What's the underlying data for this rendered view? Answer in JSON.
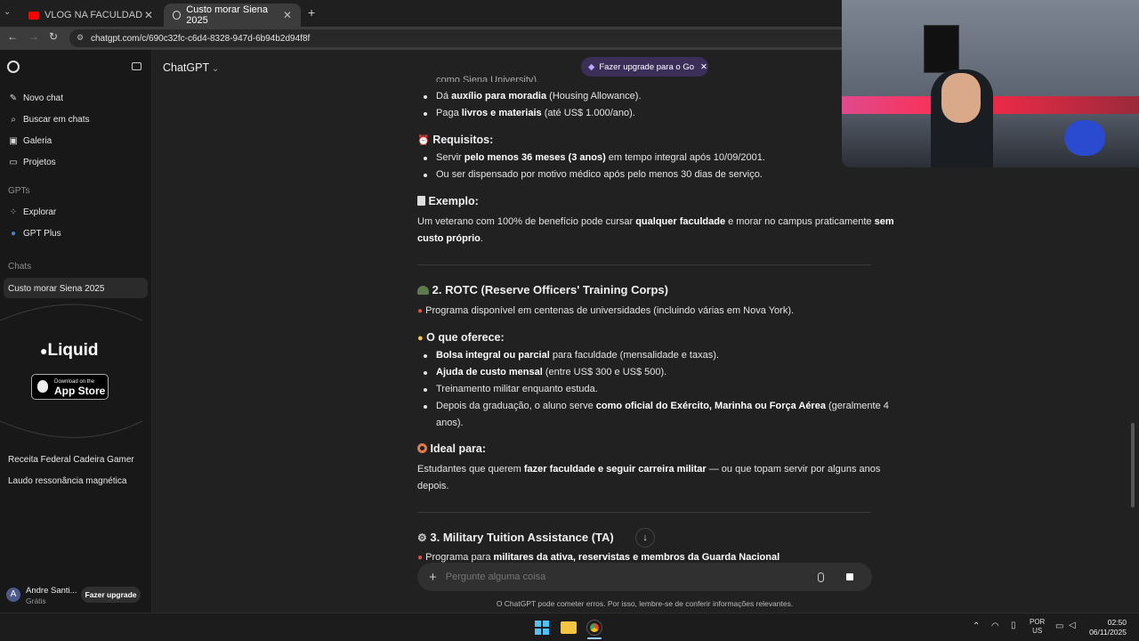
{
  "browser": {
    "tabs": [
      {
        "label": "VLOG NA FACULDADE EM NY"
      },
      {
        "label": "Custo morar Siena 2025"
      }
    ],
    "url": "chatgpt.com/c/690c32fc-c6d4-8328-947d-6b94b2d94f8f"
  },
  "sidebar": {
    "items": [
      {
        "label": "Novo chat"
      },
      {
        "label": "Buscar em chats"
      },
      {
        "label": "Galeria"
      },
      {
        "label": "Projetos"
      }
    ],
    "gpts_heading": "GPTs",
    "gpts": [
      {
        "label": "Explorar"
      },
      {
        "label": "GPT Plus"
      }
    ],
    "chats_heading": "Chats",
    "chats": [
      {
        "label": "Custo morar Siena 2025"
      },
      {
        "label": "Receita Federal Cadeira Gamer"
      },
      {
        "label": "Laudo ressonância magnética"
      }
    ],
    "ad": {
      "brand": "Liquid",
      "store_top": "Download on the",
      "store_name": "App Store"
    },
    "user": {
      "initial": "A",
      "name": "Andre Santi...",
      "plan": "Grátis",
      "upgrade": "Fazer upgrade"
    }
  },
  "header": {
    "model": "ChatGPT",
    "upgrade_pill": "Fazer upgrade para o Go"
  },
  "content": {
    "top_partial": "como Siena University).",
    "b1": [
      "Dá ",
      "auxílio para moradia",
      " (Housing Allowance)."
    ],
    "b2": [
      "Paga ",
      "livros e materiais",
      " (até US$ 1.000/ano)."
    ],
    "req_title": "Requisitos:",
    "r1": [
      "Servir ",
      "pelo menos 36 meses (3 anos)",
      " em tempo integral após 10/09/2001."
    ],
    "r2": "Ou ser dispensado por motivo médico após pelo menos 30 dias de serviço.",
    "ex_title": "Exemplo:",
    "ex_line1": [
      "Um veterano com 100% de benefício pode cursar ",
      "qualquer faculdade",
      " e morar no campus praticamente ",
      "sem"
    ],
    "ex_line2": "custo próprio",
    "rotc_title": "2. ROTC (Reserve Officers' Training Corps)",
    "rotc_line": "Programa disponível em centenas de universidades (incluindo várias em Nova York).",
    "offer_title": "O que oferece:",
    "o1": [
      "Bolsa integral ou parcial",
      " para faculdade (mensalidade e taxas)."
    ],
    "o2": [
      "Ajuda de custo mensal",
      " (entre US$ 300 e US$ 500)."
    ],
    "o3": "Treinamento militar enquanto estuda.",
    "o4": [
      "Depois da graduação, o aluno serve ",
      "como oficial do Exército, Marinha ou Força Aérea",
      " (geralmente 4"
    ],
    "o4b": "anos).",
    "ideal_title": "Ideal para:",
    "ideal_line1": [
      "Estudantes que querem ",
      "fazer faculdade e seguir carreira militar",
      " — ou que topam servir por alguns anos"
    ],
    "ideal_line2": "depois.",
    "ta_title": "3. Military Tuition Assistance (TA)",
    "bottom_partial": [
      "Programa para ",
      "militares da ativa, reservistas e membros da Guarda Nacional"
    ]
  },
  "composer": {
    "placeholder": "Pergunte alguma coisa",
    "disclaimer": "O ChatGPT pode cometer erros. Por isso, lembre-se de conferir informações relevantes."
  },
  "taskbar": {
    "lang": "POR",
    "region": "US",
    "time": "02:50",
    "date": "06/11/2025"
  },
  "colors": {
    "accent_pill": "#3b2f5a",
    "youtube": "#ff0000"
  }
}
